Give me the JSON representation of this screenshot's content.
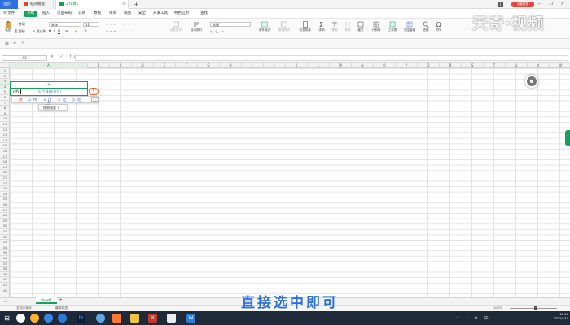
{
  "tabs": {
    "home": "首页",
    "doc": "稻壳模板",
    "sheet": "工作簿1",
    "close": "×",
    "add": "+"
  },
  "promo": "访客登录",
  "num_badge": "1",
  "window_controls": "— ❐ ✕",
  "menu": {
    "file": "≡ 文件",
    "items": [
      "开始",
      "插入",
      "页面布局",
      "公式",
      "数据",
      "审阅",
      "视图",
      "安全",
      "开发工具",
      "特色应用",
      "查找"
    ]
  },
  "ribbon": {
    "paste": "粘贴",
    "cut": "剪切",
    "copy": "复制",
    "format_painter": "格式刷",
    "font_name": "宋体",
    "font_size": "11",
    "merge_center": "合并居中",
    "auto_wrap": "自动换行",
    "number_format": "常规",
    "cond_format": "条件格式",
    "cell_style": "表格样式",
    "doc_helper": "文档助手",
    "sum": "求和",
    "filter": "筛选",
    "sort": "排序",
    "format": "格式",
    "row_col": "行和列",
    "worksheet": "工作表",
    "freeze": "冻结窗格",
    "find": "查找",
    "symbol": "符号"
  },
  "formula_bar": {
    "name_box": "A3",
    "icons": "✕ ✓ fx",
    "value": ""
  },
  "columns": [
    "A",
    "B",
    "C",
    "D",
    "E",
    "F",
    "G",
    "H",
    "I",
    "J",
    "K",
    "L",
    "M",
    "N",
    "O",
    "P",
    "Q",
    "R",
    "S",
    "T",
    "U",
    "V",
    "W"
  ],
  "rows": [
    "1",
    "2",
    "3",
    "4",
    "5",
    "6",
    "7",
    "8",
    "9",
    "10",
    "11",
    "12",
    "13",
    "14",
    "15",
    "16",
    "17",
    "18",
    "19",
    "20",
    "21",
    "22",
    "23",
    "24",
    "25",
    "26",
    "27",
    "28",
    "29",
    "30",
    "31",
    "32",
    "33",
    "34",
    "35",
    "36",
    "37",
    "38",
    "39",
    "40",
    "41",
    "42"
  ],
  "cell": {
    "text": "ch",
    "merged_marker": "+"
  },
  "ime": {
    "hint": "① 工具箱(分号)",
    "logo": "S",
    "candidates": [
      "1. 驰",
      "2. 传",
      "3. 出",
      "4. 吃",
      "5. 吃"
    ],
    "page": "‹ ›",
    "search": "搜狗搜索"
  },
  "watermark": "天奇·视频",
  "caption": "直接选中即可",
  "sheet": {
    "tab": "Sheet1",
    "add": "+"
  },
  "status": {
    "left": "文档未保存",
    "mode": "编辑状态",
    "zoom": "100%"
  },
  "clock": {
    "time": "20:06",
    "date": "2020/2/10"
  },
  "taskbar_icons": [
    "start-icon",
    "search-icon",
    "taskview-icon",
    "chrome-icon",
    "photoshop-icon",
    "edge-icon",
    "explorer-icon",
    "excel-icon",
    "qq-icon",
    "wps-icon"
  ]
}
